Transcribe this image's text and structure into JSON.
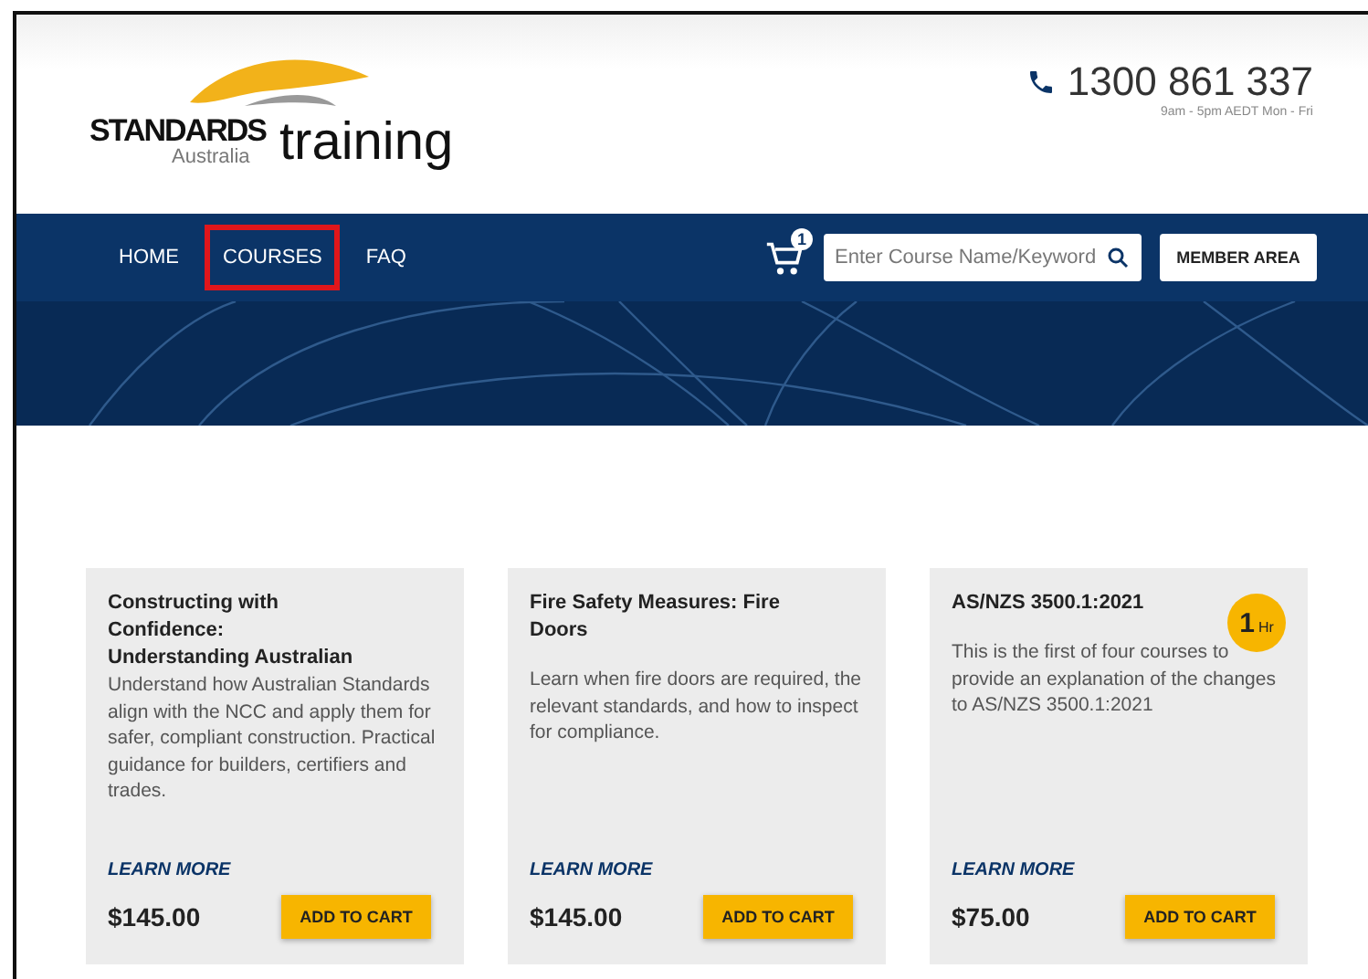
{
  "logo": {
    "brand": "STANDARDS",
    "region": "Australia",
    "product": "training"
  },
  "contact": {
    "phone": "1300 861 337",
    "hours": "9am - 5pm AEDT Mon - Fri"
  },
  "nav": {
    "items": [
      {
        "label": "HOME",
        "highlighted": false
      },
      {
        "label": "COURSES",
        "highlighted": true
      },
      {
        "label": "FAQ",
        "highlighted": false
      }
    ],
    "cart_count": "1",
    "search": {
      "placeholder": "Enter Course Name/Keyword"
    },
    "member_button": "MEMBER AREA"
  },
  "courses": [
    {
      "title": "Constructing with Confidence: Understanding Australian",
      "description": "Understand how Australian Standards align with the NCC and apply them for safer, compliant construction. Practical guidance for builders, certifiers and trades.",
      "link": "LEARN MORE",
      "price": "$145.00",
      "button": "ADD TO CART"
    },
    {
      "title": "Fire Safety Measures: Fire Doors",
      "description": "Learn when fire doors are required, the relevant standards, and how to inspect for compliance.",
      "link": "LEARN MORE",
      "price": "$145.00",
      "button": "ADD TO CART"
    },
    {
      "title": "AS/NZS 3500.1:2021",
      "duration": {
        "value": "1",
        "unit": "Hr"
      },
      "description": "This is the first of four courses to provide an explanation of the changes to AS/NZS 3500.1:2021",
      "link": "LEARN MORE",
      "price": "$75.00",
      "button": "ADD TO CART"
    }
  ]
}
